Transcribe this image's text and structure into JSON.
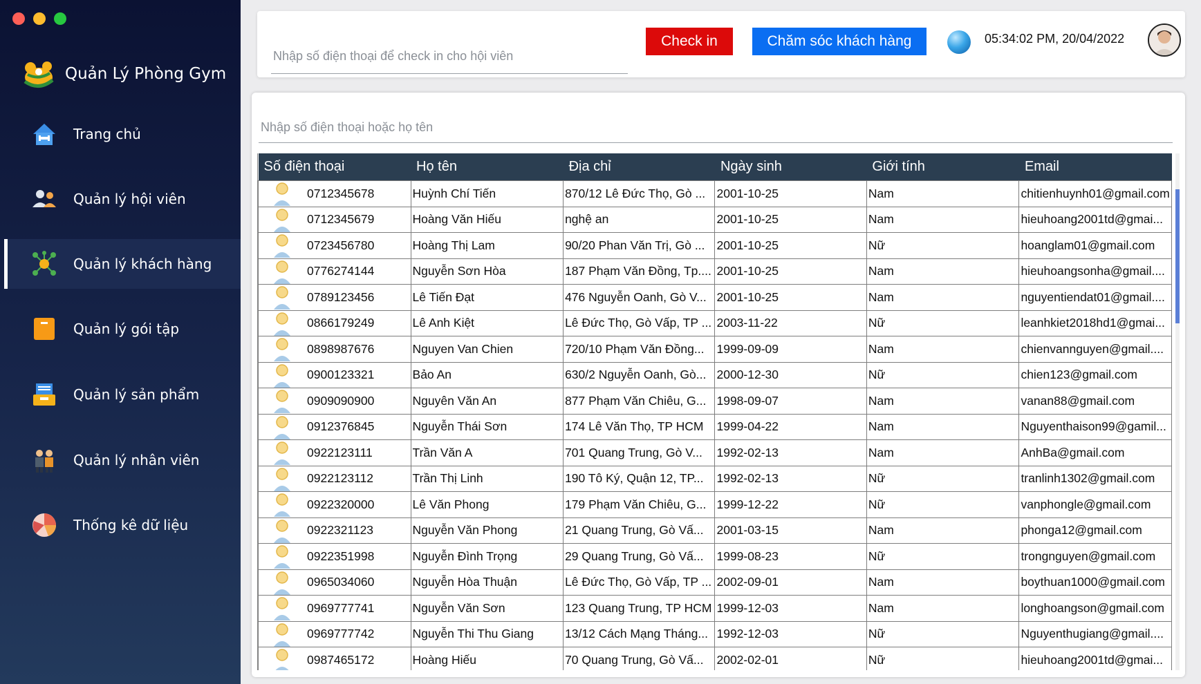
{
  "app": {
    "title": "Quản Lý Phòng Gym"
  },
  "sidebar": {
    "items": [
      {
        "label": "Trang chủ",
        "icon": "home-icon"
      },
      {
        "label": "Quản lý hội viên",
        "icon": "members-icon"
      },
      {
        "label": "Quản lý khách hàng",
        "icon": "customers-network-icon",
        "active": true
      },
      {
        "label": "Quản lý gói tập",
        "icon": "package-icon"
      },
      {
        "label": "Quản lý sản phẩm",
        "icon": "product-tray-icon"
      },
      {
        "label": "Quản lý nhân viên",
        "icon": "staff-icon"
      },
      {
        "label": "Thống kê dữ liệu",
        "icon": "pie-chart-icon"
      }
    ]
  },
  "topbar": {
    "checkin_placeholder": "Nhập số điện thoại để check in cho hội viên",
    "checkin_button": "Check in",
    "care_button": "Chăm sóc khách hàng",
    "datetime": "05:34:02 PM, 20/04/2022"
  },
  "search": {
    "placeholder": "Nhập số điện thoại hoặc họ tên"
  },
  "table": {
    "columns": [
      "Số điện thoại",
      "Họ tên",
      "Địa chỉ",
      "Ngày sinh",
      "Giới tính",
      "Email"
    ],
    "rows": [
      [
        "0712345678",
        "Huỳnh Chí Tiến",
        "870/12 Lê Đức Thọ, Gò ...",
        "2001-10-25",
        "Nam",
        "chitienhuynh01@gmail.com"
      ],
      [
        "0712345679",
        "Hoàng Văn Hiếu",
        "nghệ an",
        "2001-10-25",
        "Nam",
        "hieuhoang2001td@gmai..."
      ],
      [
        "0723456780",
        "Hoàng Thị Lam",
        "90/20 Phan Văn Trị, Gò ...",
        "2001-10-25",
        "Nữ",
        "hoanglam01@gmail.com"
      ],
      [
        "0776274144",
        "Nguyễn Sơn Hòa",
        "187 Phạm Văn Đồng, Tp....",
        "2001-10-25",
        "Nam",
        "hieuhoangsonha@gmail...."
      ],
      [
        "0789123456",
        "Lê Tiến Đạt",
        "476 Nguyễn Oanh, Gò V...",
        "2001-10-25",
        "Nam",
        "nguyentiendat01@gmail...."
      ],
      [
        "0866179249",
        "Lê Anh Kiệt",
        "Lê Đức Thọ, Gò Vấp, TP ...",
        "2003-11-22",
        "Nữ",
        "leanhkiet2018hd1@gmai..."
      ],
      [
        "0898987676",
        "Nguyen Van Chien",
        "720/10 Phạm Văn Đồng...",
        "1999-09-09",
        "Nam",
        "chienvannguyen@gmail...."
      ],
      [
        "0900123321",
        "Bảo An",
        "630/2 Nguyễn Oanh, Gò...",
        "2000-12-30",
        "Nữ",
        "chien123@gmail.com"
      ],
      [
        "0909090900",
        "Nguyên Văn An",
        "877 Phạm Văn Chiêu, G...",
        "1998-09-07",
        "Nam",
        "vanan88@gmail.com"
      ],
      [
        "0912376845",
        "Nguyễn Thái Sơn",
        "174 Lê Văn Thọ, TP HCM",
        "1999-04-22",
        "Nam",
        "Nguyenthaison99@gamil..."
      ],
      [
        "0922123111",
        "Trần Văn A",
        "701 Quang Trung, Gò V...",
        "1992-02-13",
        "Nam",
        "AnhBa@gmail.com"
      ],
      [
        "0922123112",
        "Trần Thị Linh",
        "190 Tô Ký, Quận 12, TP...",
        "1992-02-13",
        "Nữ",
        "tranlinh1302@gmail.com"
      ],
      [
        "0922320000",
        "Lê Văn Phong",
        "179 Phạm Văn Chiêu, G...",
        "1999-12-22",
        "Nữ",
        "vanphongle@gmail.com"
      ],
      [
        "0922321123",
        "Nguyễn Văn Phong",
        "21 Quang Trung, Gò Vấ...",
        "2001-03-15",
        "Nam",
        "phonga12@gmail.com"
      ],
      [
        "0922351998",
        "Nguyễn Đình Trọng",
        "29 Quang Trung, Gò Vấ...",
        "1999-08-23",
        "Nữ",
        "trongnguyen@gmail.com"
      ],
      [
        "0965034060",
        "Nguyễn Hòa Thuận",
        "Lê Đức Thọ, Gò Vấp, TP ...",
        "2002-09-01",
        "Nam",
        "boythuan1000@gmail.com"
      ],
      [
        "0969777741",
        "Nguyễn Văn Sơn",
        "123 Quang Trung, TP HCM",
        "1999-12-03",
        "Nam",
        "longhoangson@gmail.com"
      ],
      [
        "0969777742",
        "Nguyễn Thi Thu Giang",
        "13/12 Cách Mạng Tháng...",
        "1992-12-03",
        "Nữ",
        "Nguyenthugiang@gmail...."
      ],
      [
        "0987465172",
        "Hoàng Hiếu",
        "70 Quang Trung, Gò Vấ...",
        "2002-02-01",
        "Nữ",
        "hieuhoang2001td@gmai..."
      ]
    ]
  },
  "colors": {
    "checkin": "#dc0a0a",
    "care": "#0a6ef2",
    "header": "#2b3e51",
    "sidebar": "#0b1233"
  }
}
